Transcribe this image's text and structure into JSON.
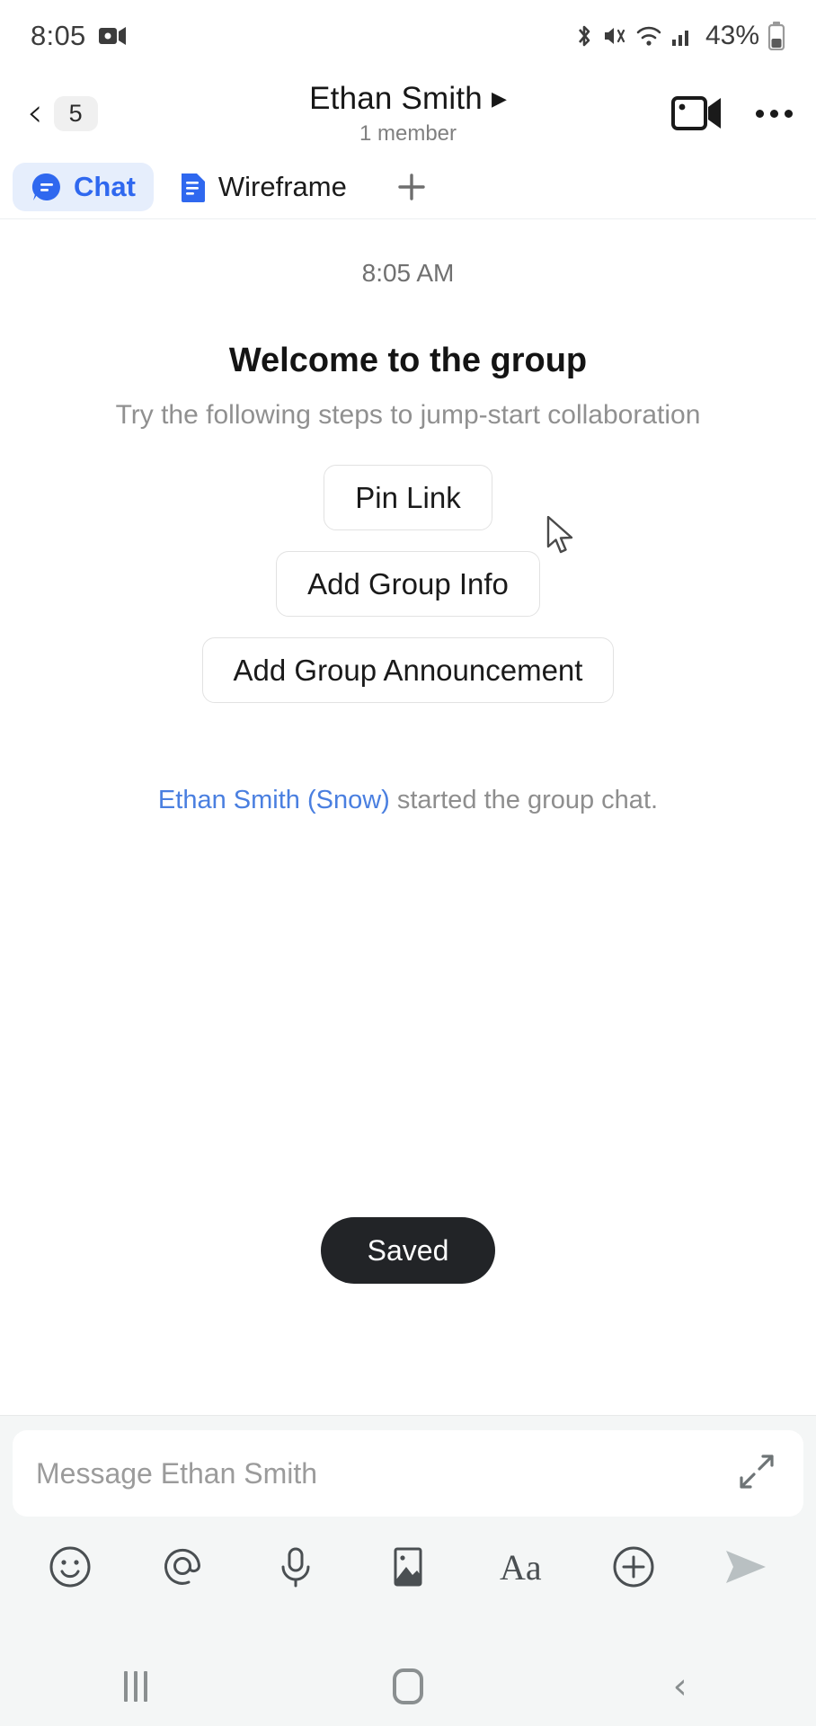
{
  "statusbar": {
    "time": "8:05",
    "battery_text": "43%",
    "icons": [
      "screen-record-icon",
      "bluetooth-icon",
      "mute-icon",
      "wifi-icon",
      "cellular-signal-icon",
      "battery-icon"
    ]
  },
  "header": {
    "back_badge": "5",
    "title": "Ethan Smith",
    "caret": "▶",
    "subtitle": "1 member",
    "video_call_label": "video-call",
    "more_label": "more-options"
  },
  "tabs": {
    "items": [
      {
        "label": "Chat",
        "icon": "chat-bubble-icon",
        "active": true
      },
      {
        "label": "Wireframe",
        "icon": "document-icon",
        "active": false
      }
    ],
    "add_label": "+"
  },
  "chat": {
    "daystamp": "8:05 AM",
    "welcome_title": "Welcome to the group",
    "welcome_subtitle": "Try the following steps to jump-start collaboration",
    "steps": [
      {
        "label": "Pin Link"
      },
      {
        "label": "Add Group Info"
      },
      {
        "label": "Add Group Announcement"
      }
    ],
    "system_message_actor": "Ethan Smith (Snow)",
    "system_message_rest": " started the group chat.",
    "toast": "Saved"
  },
  "composer": {
    "placeholder": "Message Ethan Smith",
    "value": "",
    "expand_label": "expand-composer",
    "tools": [
      {
        "name": "emoji-icon"
      },
      {
        "name": "mention-icon"
      },
      {
        "name": "microphone-icon"
      },
      {
        "name": "image-icon"
      },
      {
        "name": "text-format-icon",
        "label": "Aa"
      },
      {
        "name": "add-attachment-icon"
      }
    ],
    "send_label": "send"
  },
  "navbar": {
    "recents_label": "recents",
    "home_label": "home",
    "back_label": "back"
  },
  "colors": {
    "accent_blue": "#2f68ef",
    "tab_active_bg": "#e6eefc",
    "link_blue": "#4a7fe0",
    "toast_bg": "#222427",
    "muted_text": "#8e8e8e"
  }
}
